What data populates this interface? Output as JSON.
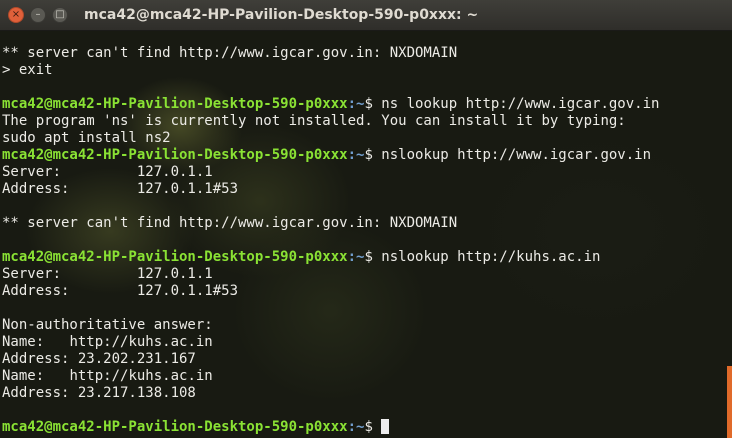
{
  "window": {
    "title": "mca42@mca42-HP-Pavilion-Desktop-590-p0xxx: ~",
    "buttons": {
      "close": "×",
      "minimize": "–",
      "maximize": "□"
    }
  },
  "terminal": {
    "prompt": {
      "user_host": "mca42@mca42-HP-Pavilion-Desktop-590-p0xxx",
      "path": ":~",
      "symbol": "$ "
    },
    "lines": [
      {
        "type": "text",
        "text": "** server can't find http://www.igcar.gov.in: NXDOMAIN"
      },
      {
        "type": "text",
        "text": "> exit"
      },
      {
        "type": "text",
        "text": ""
      },
      {
        "type": "prompt",
        "command": "ns lookup http://www.igcar.gov.in"
      },
      {
        "type": "text",
        "text": "The program 'ns' is currently not installed. You can install it by typing:"
      },
      {
        "type": "text",
        "text": "sudo apt install ns2"
      },
      {
        "type": "prompt",
        "command": "nslookup http://www.igcar.gov.in"
      },
      {
        "type": "text",
        "text": "Server:\t\t127.0.1.1"
      },
      {
        "type": "text",
        "text": "Address:\t127.0.1.1#53"
      },
      {
        "type": "text",
        "text": ""
      },
      {
        "type": "text",
        "text": "** server can't find http://www.igcar.gov.in: NXDOMAIN"
      },
      {
        "type": "text",
        "text": ""
      },
      {
        "type": "prompt",
        "command": "nslookup http://kuhs.ac.in"
      },
      {
        "type": "text",
        "text": "Server:\t\t127.0.1.1"
      },
      {
        "type": "text",
        "text": "Address:\t127.0.1.1#53"
      },
      {
        "type": "text",
        "text": ""
      },
      {
        "type": "text",
        "text": "Non-authoritative answer:"
      },
      {
        "type": "text",
        "text": "Name:\thttp://kuhs.ac.in"
      },
      {
        "type": "text",
        "text": "Address: 23.202.231.167"
      },
      {
        "type": "text",
        "text": "Name:\thttp://kuhs.ac.in"
      },
      {
        "type": "text",
        "text": "Address: 23.217.138.108"
      },
      {
        "type": "text",
        "text": ""
      },
      {
        "type": "prompt",
        "command": "",
        "cursor": true
      }
    ]
  },
  "colors": {
    "prompt_user": "#8ae234",
    "prompt_path": "#729fcf",
    "text": "#ecebe6",
    "close_button": "#e0603a"
  }
}
